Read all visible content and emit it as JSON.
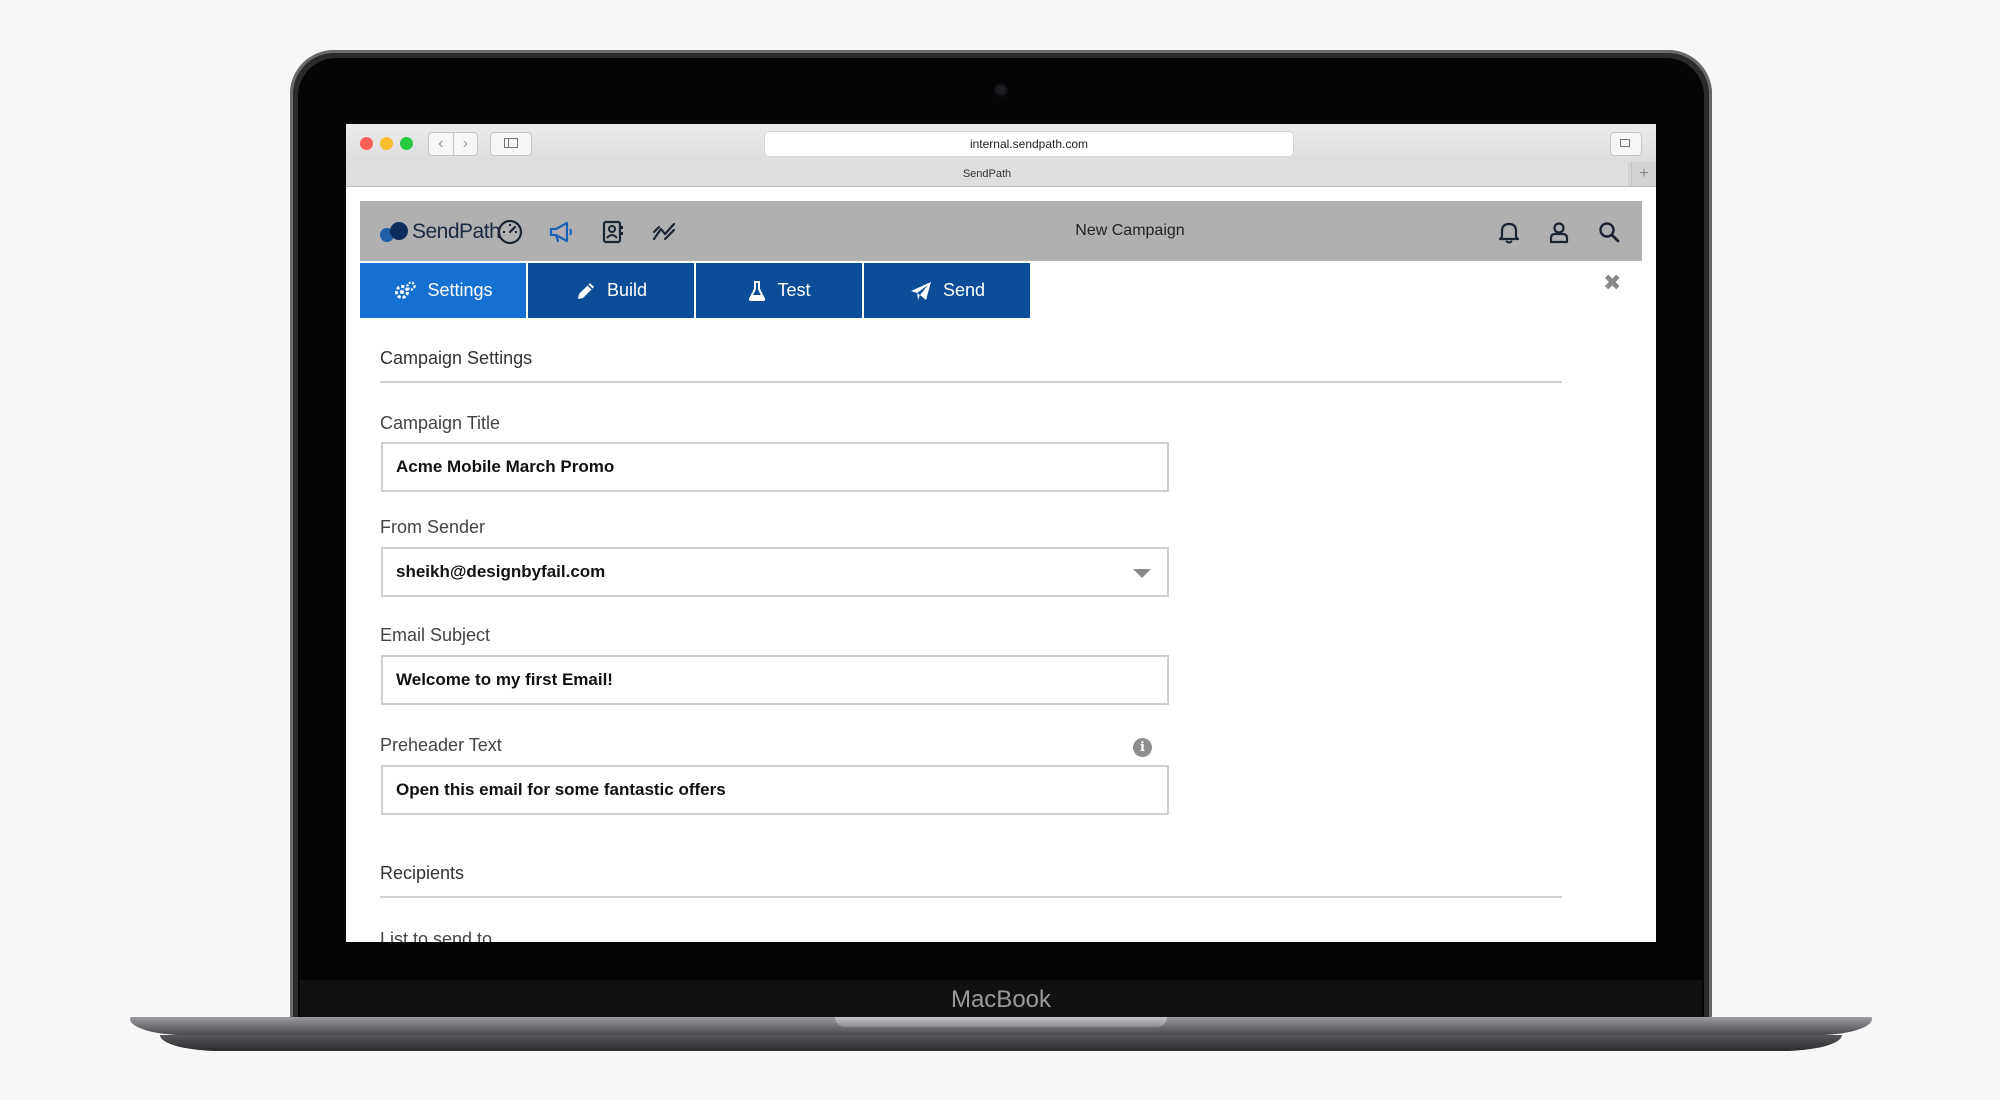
{
  "device": {
    "brand": "MacBook"
  },
  "browser": {
    "url": "internal.sendpath.com",
    "tab_title": "SendPath",
    "nav_back": "‹",
    "nav_forward": "›",
    "new_tab": "+"
  },
  "app": {
    "logo_text": "SendPath",
    "page_title": "New Campaign",
    "brand_color": "#0b4e97",
    "active_color": "#1670d1",
    "nav_icons": [
      "dashboard-icon",
      "megaphone-icon",
      "contacts-icon",
      "analytics-icon"
    ],
    "header_icons": [
      "bell-icon",
      "user-icon",
      "search-icon"
    ]
  },
  "steps": [
    {
      "label": "Settings",
      "icon": "gears-icon",
      "active": true
    },
    {
      "label": "Build",
      "icon": "pencil-icon",
      "active": false
    },
    {
      "label": "Test",
      "icon": "flask-icon",
      "active": false
    },
    {
      "label": "Send",
      "icon": "paper-plane-icon",
      "active": false
    }
  ],
  "close_glyph": "✖",
  "form": {
    "section_settings": "Campaign Settings",
    "campaign_title": {
      "label": "Campaign Title",
      "value": "Acme Mobile March Promo"
    },
    "from_sender": {
      "label": "From Sender",
      "value": "sheikh@designbyfail.com"
    },
    "email_subject": {
      "label": "Email Subject",
      "value": "Welcome to my first Email!"
    },
    "preheader": {
      "label": "Preheader Text",
      "value": "Open this email for some fantastic offers",
      "info_glyph": "i"
    },
    "section_recipients": "Recipients",
    "list_label": "List to send to"
  }
}
